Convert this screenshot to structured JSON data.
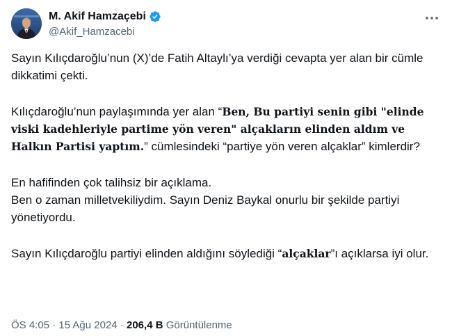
{
  "author": {
    "display_name": "M. Akif Hamzaçebi",
    "handle": "@Akif_Hamzacebi",
    "verified": true,
    "avatar_icon": "profile-photo"
  },
  "tweet": {
    "p1": "Sayın Kılıçdaroğlu’nun (X)’de Fatih Altaylı’ya verdiği cevapta yer alan bir cümle dikkatimi çekti.",
    "p2_pre": "Kılıçdaroğlu’nun paylaşımında yer alan “",
    "p2_quote": "Ben, Bu partiyi senin gibi \"elinde viski kadehleriyle partime yön veren\" alçakların elinden aldım ve Halkın Partisi yaptım.",
    "p2_post": "” cümlesindeki “partiye yön veren alçaklar” kimlerdir?",
    "p3_line1": "En hafifinden çok talihsiz bir açıklama.",
    "p3_line2": "Ben o zaman milletvekiliydim. Sayın Deniz Baykal onurlu bir şekilde partiyi yönetiyordu.",
    "p4_pre": "Sayın Kılıçdaroğlu partiyi elinden aldığını söylediği “",
    "p4_quote": "alçaklar",
    "p4_post": "”ı açıklarsa iyi olur."
  },
  "meta": {
    "time": "ÖS 4:05",
    "separator": " · ",
    "date": "15 Ağu 2024",
    "views_count": "206,4 B",
    "views_label": "Görüntülenme"
  },
  "colors": {
    "text": "#0f1419",
    "secondary": "#536471",
    "verified": "#1d9bf0"
  }
}
